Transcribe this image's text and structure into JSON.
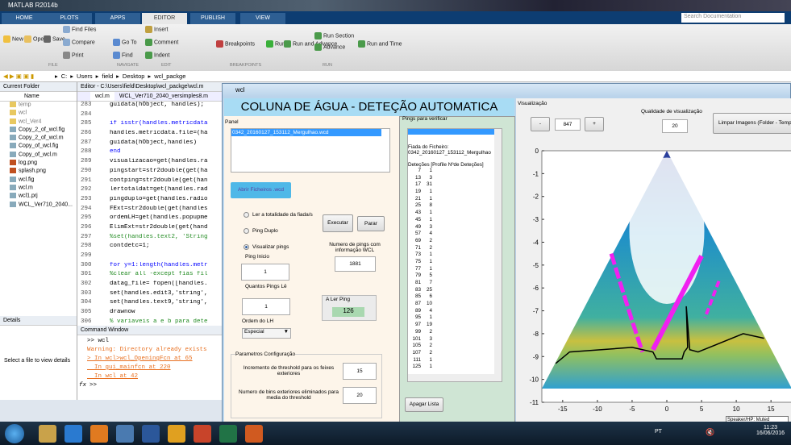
{
  "app": {
    "title": "MATLAB R2014b"
  },
  "tabs": [
    "HOME",
    "PLOTS",
    "APPS",
    "EDITOR",
    "PUBLISH",
    "VIEW"
  ],
  "search": {
    "placeholder": "Search Documentation"
  },
  "toolstrip": {
    "file": [
      "New",
      "Open",
      "Save",
      "Find Files",
      "Compare",
      "Print"
    ],
    "navigate": [
      "Go To",
      "Find"
    ],
    "edit": [
      "Insert",
      "Comment",
      "Indent"
    ],
    "breakpoints": [
      "Breakpoints"
    ],
    "run": [
      "Run",
      "Run and Advance",
      "Run Section",
      "Advance",
      "Run and Time"
    ],
    "groups": [
      "FILE",
      "NAVIGATE",
      "EDIT",
      "BREAKPOINTS",
      "RUN"
    ]
  },
  "address": [
    "C:",
    "Users",
    "field",
    "Desktop",
    "wcl_packge"
  ],
  "current_folder": {
    "title": "Current Folder",
    "column": "Name",
    "items": [
      "temp",
      "wcl",
      "wcl_Ver4",
      "Copy_2_of_wcl.fig",
      "Copy_2_of_wcl.m",
      "Copy_of_wcl.fig",
      "Copy_of_wcl.m",
      "log.png",
      "splash.png",
      "wcl.fig",
      "wcl.m",
      "wcl1.prj",
      "WCL_Ver710_2040..."
    ]
  },
  "details": {
    "title": "Details",
    "text": "Select a file to view details"
  },
  "editor": {
    "title": "Editor - C:\\Users\\field\\Desktop\\wcl_packge\\wcl.m",
    "tabs": [
      "wcl.m",
      "WCL_Ver710_2040_versimples8.m"
    ],
    "lines": [
      [
        "283",
        "guidata(hObject, handles);"
      ],
      [
        "284",
        ""
      ],
      [
        "285",
        "if isstr(handles.metricdata"
      ],
      [
        "286",
        "handles.metricdata.file=(ha"
      ],
      [
        "287",
        "guidata(hObject,handles)"
      ],
      [
        "288",
        "end"
      ],
      [
        "289",
        "visualizacao=get(handles.ra"
      ],
      [
        "290",
        "pingstart=str2double(get(ha"
      ],
      [
        "291",
        "contping=str2double(get(han"
      ],
      [
        "292",
        "lertotaldat=get(handles.rad"
      ],
      [
        "293",
        "pingduplo=get(handles.radio"
      ],
      [
        "294",
        "FExt=str2double(get(handles"
      ],
      [
        "295",
        "ordemLH=get(handles.popupme"
      ],
      [
        "296",
        "ElimExt=str2double(get(hand"
      ],
      [
        "297",
        "%set(handles.text2, 'String"
      ],
      [
        "298",
        "contdetc=1;"
      ],
      [
        "299",
        ""
      ],
      [
        "300",
        "for y=1:length(handles.metr"
      ],
      [
        "301",
        "%clear all -except fias fil"
      ],
      [
        "302",
        "datag_file= fopen([handles."
      ],
      [
        "303",
        "set(handles.edit3,'string',"
      ],
      [
        "304",
        "set(handles.text9,'string',"
      ],
      [
        "305",
        "drawnow"
      ],
      [
        "306",
        "% variaveis a e b para dete"
      ]
    ]
  },
  "command_window": {
    "title": "Command Window",
    "lines": [
      ">> wcl",
      "Warning: Directory already exists",
      "> In wcl>wcl_OpeningFcn at 65",
      "  In gui_mainfcn at 220",
      "  In wcl at 42"
    ],
    "prompt": ">>"
  },
  "wcl": {
    "title": "wcl",
    "header": "COLUNA DE ÁGUA - DETEÇÃO AUTOMATICA",
    "panel": {
      "title": "Panel",
      "file_list": [
        "0342_20160127_153112_Mergulhao.wcd"
      ],
      "add_button": "Abrir Ficheiros .wcd",
      "radios": [
        {
          "label": "Ler a totalidade da fiada/s",
          "checked": false
        },
        {
          "label": "Ping Duplo",
          "checked": false
        },
        {
          "label": "Visualizar pings",
          "checked": true
        }
      ],
      "execute": "Executar",
      "stop": "Parar",
      "ping_inicio_label": "Ping Inicio",
      "ping_inicio": "1",
      "quantos_label": "Quantos Pings Lê",
      "quantos": "1",
      "ordem_label": "Ordem do LH",
      "ordem": "Especial",
      "num_pings_label": "Numero de pings com informação WCL",
      "num_pings": "1881",
      "a_ler_label": "A Ler Ping",
      "a_ler": "126",
      "params": {
        "title": "Parametros Configuração",
        "threshold_label": "Incremento de threshold para os feixes exteriores",
        "threshold": "15",
        "bins_label": "Numero de bins exteriores eliminados para media do threshold",
        "bins": "20"
      }
    },
    "pings": {
      "title": "Pings para verificar",
      "fiada_label": "Fiada do Ficheiro:",
      "fiada": "0342_20160127_153112_Mergulhao",
      "det_header": "Deteções [Profile Nºde Deteções]",
      "detections": [
        [
          "7",
          "1"
        ],
        [
          "13",
          "3"
        ],
        [
          "17",
          "31"
        ],
        [
          "19",
          "1"
        ],
        [
          "21",
          "1"
        ],
        [
          "25",
          "8"
        ],
        [
          "43",
          "1"
        ],
        [
          "45",
          "1"
        ],
        [
          "49",
          "3"
        ],
        [
          "57",
          "4"
        ],
        [
          "69",
          "2"
        ],
        [
          "71",
          "2"
        ],
        [
          "73",
          "1"
        ],
        [
          "75",
          "1"
        ],
        [
          "77",
          "1"
        ],
        [
          "79",
          "5"
        ],
        [
          "81",
          "7"
        ],
        [
          "83",
          "25"
        ],
        [
          "85",
          "6"
        ],
        [
          "87",
          "10"
        ],
        [
          "89",
          "4"
        ],
        [
          "95",
          "1"
        ],
        [
          "97",
          "19"
        ],
        [
          "99",
          "2"
        ],
        [
          "101",
          "3"
        ],
        [
          "105",
          "2"
        ],
        [
          "107",
          "2"
        ],
        [
          "111",
          "1"
        ],
        [
          "125",
          "1"
        ]
      ],
      "clear": "Apagar Lista"
    },
    "vis": {
      "title": "Visualização",
      "minus": "-",
      "plus": "+",
      "ping": "847",
      "quality_label": "Qualidade de visualização",
      "quality": "20",
      "clear_images": "Limpar Imagens (Folder - Temp)",
      "plot": {
        "type": "scatter",
        "xlim": [
          -18,
          18
        ],
        "ylim": [
          -11,
          0
        ],
        "xticks": [
          "-15",
          "-10",
          "-5",
          "0",
          "5",
          "10",
          "15"
        ],
        "yticks": [
          "0",
          "-1",
          "-2",
          "-3",
          "-4",
          "-5",
          "-6",
          "-7",
          "-8",
          "-9",
          "-10",
          "-11"
        ]
      }
    }
  },
  "taskbar": {
    "lang": "PT",
    "time": "11:23",
    "date": "16/06/2016",
    "tooltip": "Speaker/HP: Muted"
  }
}
